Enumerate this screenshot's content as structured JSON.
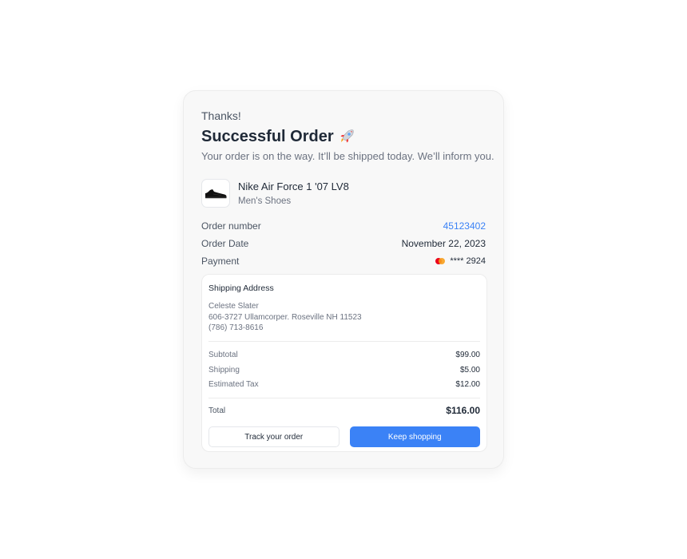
{
  "header": {
    "thanks": "Thanks!",
    "title": "Successful Order",
    "title_icon": "rocket-icon",
    "subtitle": "Your order is on the way. It’ll be shipped today. We’ll inform you."
  },
  "product": {
    "name": "Nike Air Force 1 '07 LV8",
    "category": "Men's Shoes",
    "image_icon": "sneaker-icon"
  },
  "meta": {
    "order_number_label": "Order number",
    "order_number": "45123402",
    "order_date_label": "Order Date",
    "order_date": "November 22, 2023",
    "payment_label": "Payment",
    "payment_value": "**** 2924",
    "payment_icon": "mastercard-icon"
  },
  "shipping": {
    "title": "Shipping Address",
    "name": "Celeste Slater",
    "address": "606-3727 Ullamcorper. Roseville NH 11523",
    "phone": "(786) 713-8616"
  },
  "summary": {
    "subtotal_label": "Subtotal",
    "subtotal": "$99.00",
    "shipping_label": "Shipping",
    "shipping": "$5.00",
    "tax_label": "Estimated Tax",
    "tax": "$12.00",
    "total_label": "Total",
    "total": "$116.00"
  },
  "actions": {
    "track_label": "Track your order",
    "keep_label": "Keep shopping"
  },
  "colors": {
    "accent": "#3b82f6",
    "card_bg": "#f8f8f8"
  }
}
